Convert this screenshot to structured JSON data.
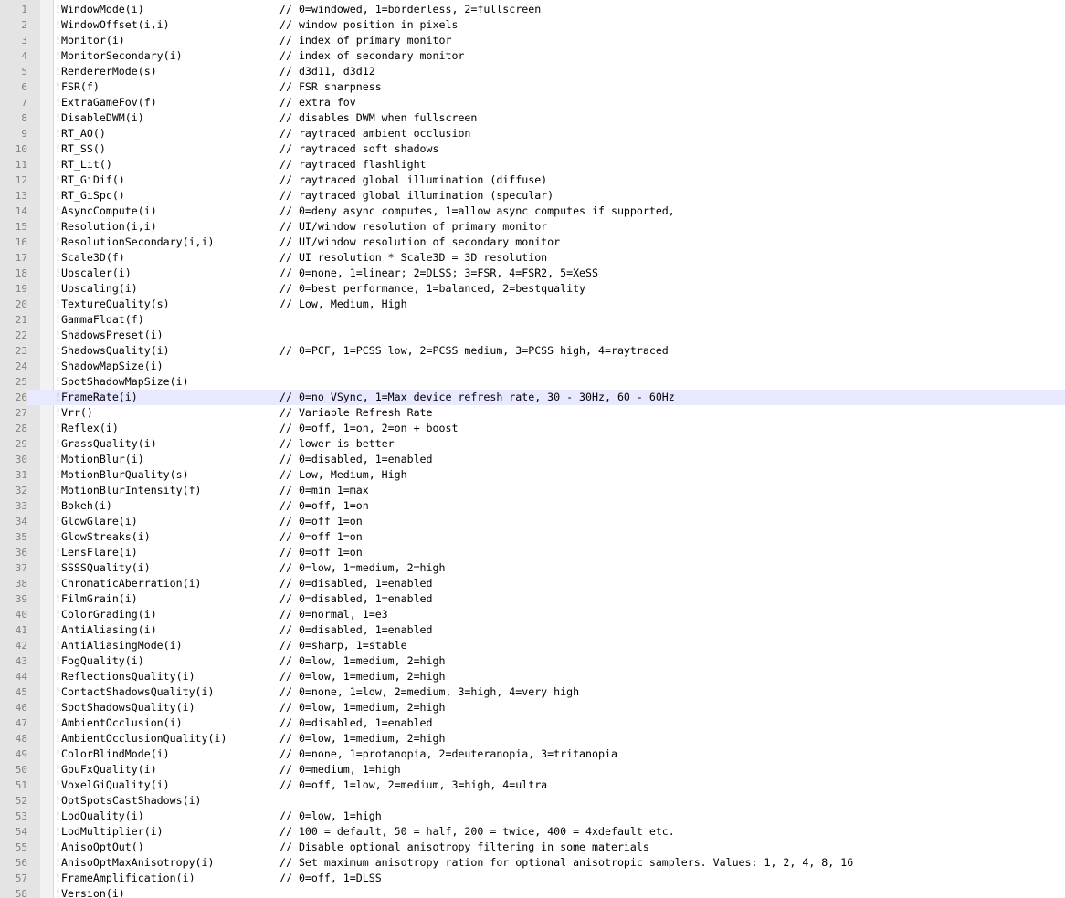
{
  "editor": {
    "current_line": 26,
    "lines": [
      {
        "num": "1",
        "key": "!WindowMode(i)",
        "comment": "// 0=windowed, 1=borderless, 2=fullscreen"
      },
      {
        "num": "2",
        "key": "!WindowOffset(i,i)",
        "comment": "// window position in pixels"
      },
      {
        "num": "3",
        "key": "!Monitor(i)",
        "comment": "// index of primary monitor"
      },
      {
        "num": "4",
        "key": "!MonitorSecondary(i)",
        "comment": "// index of secondary monitor"
      },
      {
        "num": "5",
        "key": "!RendererMode(s)",
        "comment": "// d3d11, d3d12"
      },
      {
        "num": "6",
        "key": "!FSR(f)",
        "comment": "// FSR sharpness"
      },
      {
        "num": "7",
        "key": "!ExtraGameFov(f)",
        "comment": "// extra fov"
      },
      {
        "num": "8",
        "key": "!DisableDWM(i)",
        "comment": "// disables DWM when fullscreen"
      },
      {
        "num": "9",
        "key": "!RT_AO()",
        "comment": "// raytraced ambient occlusion"
      },
      {
        "num": "10",
        "key": "!RT_SS()",
        "comment": "// raytraced soft shadows"
      },
      {
        "num": "11",
        "key": "!RT_Lit()",
        "comment": "// raytraced flashlight"
      },
      {
        "num": "12",
        "key": "!RT_GiDif()",
        "comment": "// raytraced global illumination (diffuse)"
      },
      {
        "num": "13",
        "key": "!RT_GiSpc()",
        "comment": "// raytraced global illumination (specular)"
      },
      {
        "num": "14",
        "key": "!AsyncCompute(i)",
        "comment": "// 0=deny async computes, 1=allow async computes if supported,"
      },
      {
        "num": "15",
        "key": "!Resolution(i,i)",
        "comment": "// UI/window resolution of primary monitor"
      },
      {
        "num": "16",
        "key": "!ResolutionSecondary(i,i)",
        "comment": "// UI/window resolution of secondary monitor"
      },
      {
        "num": "17",
        "key": "!Scale3D(f)",
        "comment": "// UI resolution * Scale3D = 3D resolution"
      },
      {
        "num": "18",
        "key": "!Upscaler(i)",
        "comment": "// 0=none, 1=linear; 2=DLSS; 3=FSR, 4=FSR2, 5=XeSS"
      },
      {
        "num": "19",
        "key": "!Upscaling(i)",
        "comment": "// 0=best performance, 1=balanced, 2=bestquality"
      },
      {
        "num": "20",
        "key": "!TextureQuality(s)",
        "comment": "// Low, Medium, High"
      },
      {
        "num": "21",
        "key": "!GammaFloat(f)",
        "comment": ""
      },
      {
        "num": "22",
        "key": "!ShadowsPreset(i)",
        "comment": ""
      },
      {
        "num": "23",
        "key": "!ShadowsQuality(i)",
        "comment": "// 0=PCF, 1=PCSS low, 2=PCSS medium, 3=PCSS high, 4=raytraced"
      },
      {
        "num": "24",
        "key": "!ShadowMapSize(i)",
        "comment": ""
      },
      {
        "num": "25",
        "key": "!SpotShadowMapSize(i)",
        "comment": ""
      },
      {
        "num": "26",
        "key": "!FrameRate(i)",
        "comment": "// 0=no VSync, 1=Max device refresh rate, 30 - 30Hz, 60 - 60Hz"
      },
      {
        "num": "27",
        "key": "!Vrr()",
        "comment": "// Variable Refresh Rate"
      },
      {
        "num": "28",
        "key": "!Reflex(i)",
        "comment": "// 0=off, 1=on, 2=on + boost"
      },
      {
        "num": "29",
        "key": "!GrassQuality(i)",
        "comment": "// lower is better"
      },
      {
        "num": "30",
        "key": "!MotionBlur(i)",
        "comment": "// 0=disabled, 1=enabled"
      },
      {
        "num": "31",
        "key": "!MotionBlurQuality(s)",
        "comment": "// Low, Medium, High"
      },
      {
        "num": "32",
        "key": "!MotionBlurIntensity(f)",
        "comment": "// 0=min 1=max"
      },
      {
        "num": "33",
        "key": "!Bokeh(i)",
        "comment": "// 0=off, 1=on"
      },
      {
        "num": "34",
        "key": "!GlowGlare(i)",
        "comment": "// 0=off 1=on"
      },
      {
        "num": "35",
        "key": "!GlowStreaks(i)",
        "comment": "// 0=off 1=on"
      },
      {
        "num": "36",
        "key": "!LensFlare(i)",
        "comment": "// 0=off 1=on"
      },
      {
        "num": "37",
        "key": "!SSSSQuality(i)",
        "comment": "// 0=low, 1=medium, 2=high"
      },
      {
        "num": "38",
        "key": "!ChromaticAberration(i)",
        "comment": "// 0=disabled, 1=enabled"
      },
      {
        "num": "39",
        "key": "!FilmGrain(i)",
        "comment": "// 0=disabled, 1=enabled"
      },
      {
        "num": "40",
        "key": "!ColorGrading(i)",
        "comment": "// 0=normal, 1=e3"
      },
      {
        "num": "41",
        "key": "!AntiAliasing(i)",
        "comment": "// 0=disabled, 1=enabled"
      },
      {
        "num": "42",
        "key": "!AntiAliasingMode(i)",
        "comment": "// 0=sharp, 1=stable"
      },
      {
        "num": "43",
        "key": "!FogQuality(i)",
        "comment": "// 0=low, 1=medium, 2=high"
      },
      {
        "num": "44",
        "key": "!ReflectionsQuality(i)",
        "comment": "// 0=low, 1=medium, 2=high"
      },
      {
        "num": "45",
        "key": "!ContactShadowsQuality(i)",
        "comment": "// 0=none, 1=low, 2=medium, 3=high, 4=very high"
      },
      {
        "num": "46",
        "key": "!SpotShadowsQuality(i)",
        "comment": "// 0=low, 1=medium, 2=high"
      },
      {
        "num": "47",
        "key": "!AmbientOcclusion(i)",
        "comment": "// 0=disabled, 1=enabled"
      },
      {
        "num": "48",
        "key": "!AmbientOcclusionQuality(i)",
        "comment": "// 0=low, 1=medium, 2=high"
      },
      {
        "num": "49",
        "key": "!ColorBlindMode(i)",
        "comment": "// 0=none, 1=protanopia, 2=deuteranopia, 3=tritanopia"
      },
      {
        "num": "50",
        "key": "!GpuFxQuality(i)",
        "comment": "// 0=medium, 1=high"
      },
      {
        "num": "51",
        "key": "!VoxelGiQuality(i)",
        "comment": "// 0=off, 1=low, 2=medium, 3=high, 4=ultra"
      },
      {
        "num": "52",
        "key": "!OptSpotsCastShadows(i)",
        "comment": ""
      },
      {
        "num": "53",
        "key": "!LodQuality(i)",
        "comment": "// 0=low, 1=high"
      },
      {
        "num": "54",
        "key": "!LodMultiplier(i)",
        "comment": "// 100 = default, 50 = half, 200 = twice, 400 = 4xdefault etc."
      },
      {
        "num": "55",
        "key": "!AnisoOptOut()",
        "comment": "// Disable optional anisotropy filtering in some materials"
      },
      {
        "num": "56",
        "key": "!AnisoOptMaxAnisotropy(i)",
        "comment": "// Set maximum anisotropy ration for optional anisotropic samplers. Values: 1, 2, 4, 8, 16"
      },
      {
        "num": "57",
        "key": "!FrameAmplification(i)",
        "comment": "// 0=off, 1=DLSS"
      },
      {
        "num": "58",
        "key": "!Version(i)",
        "comment": ""
      }
    ]
  }
}
